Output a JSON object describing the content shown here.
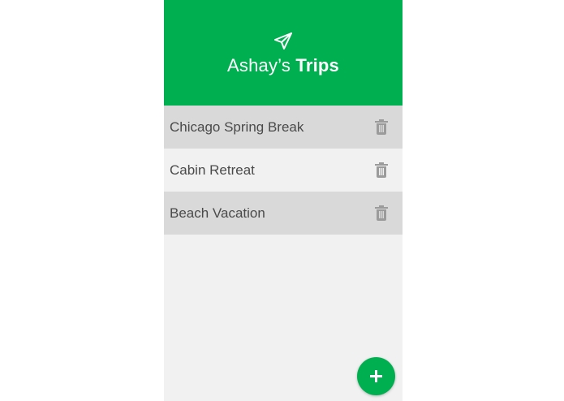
{
  "header": {
    "icon": "paper-plane-icon",
    "title_prefix": "Ashay’s",
    "title_bold": "Trips",
    "background": "#00b050"
  },
  "trips": [
    {
      "name": "Chicago Spring Break",
      "delete_icon": "trash-icon"
    },
    {
      "name": "Cabin Retreat",
      "delete_icon": "trash-icon"
    },
    {
      "name": "Beach Vacation",
      "delete_icon": "trash-icon"
    }
  ],
  "fab": {
    "icon": "plus-icon",
    "color": "#00b050"
  },
  "colors": {
    "row_dark": "#d9d9d9",
    "row_light": "#f1f1f1",
    "text": "#4a4a4a",
    "icon_gray": "#9b9b9b"
  }
}
